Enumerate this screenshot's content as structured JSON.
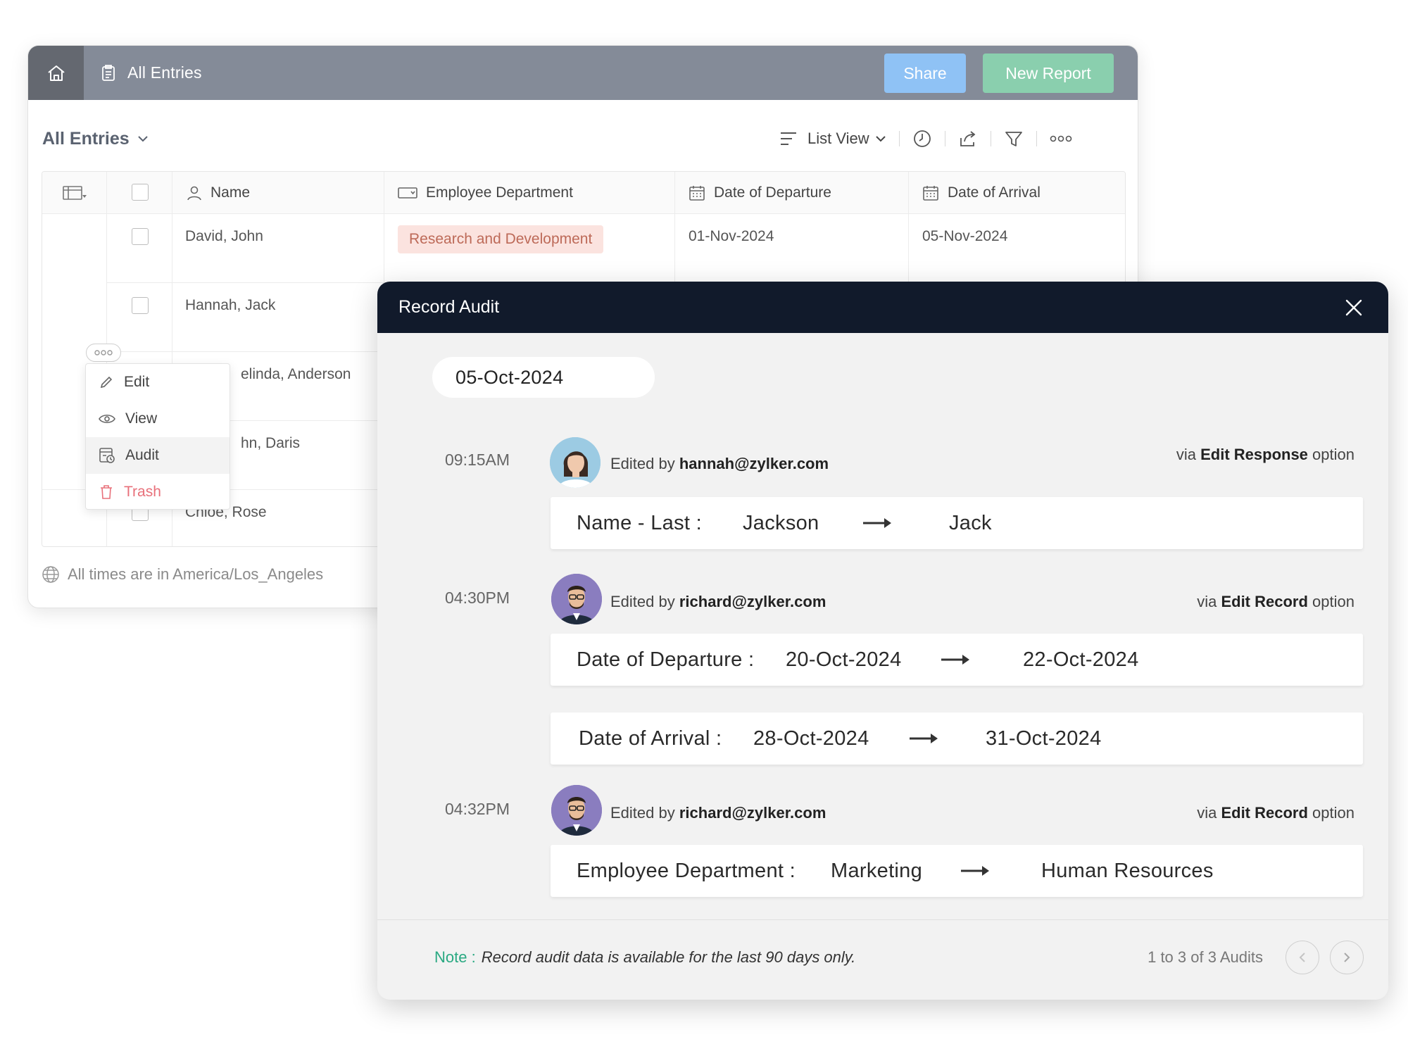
{
  "topbar": {
    "title": "All Entries",
    "share_label": "Share",
    "new_report_label": "New Report",
    "icons": [
      "home-icon",
      "report-icon"
    ],
    "colors": {
      "bar": "#848b98",
      "home": "#646870",
      "share": "#8fc2f5",
      "new_report": "#8acfae"
    }
  },
  "list": {
    "title": "All Entries",
    "view_label": "List View"
  },
  "table": {
    "headers": {
      "name": "Name",
      "department": "Employee Department",
      "departure": "Date of Departure",
      "arrival": "Date of Arrival"
    },
    "rows": [
      {
        "name": "David, John",
        "department": "Research and Development",
        "departure": "01-Nov-2024",
        "arrival": "05-Nov-2024"
      },
      {
        "name": "Hannah, Jack"
      },
      {
        "name": "elinda, Anderson"
      },
      {
        "name": "hn, Daris"
      },
      {
        "name": "Chloe, Rose"
      }
    ],
    "timezone_note": "All times are in America/Los_Angeles"
  },
  "context_menu": {
    "items": [
      {
        "label": "Edit",
        "icon": "pencil-icon"
      },
      {
        "label": "View",
        "icon": "eye-icon"
      },
      {
        "label": "Audit",
        "icon": "audit-icon"
      },
      {
        "label": "Trash",
        "icon": "trash-icon"
      }
    ]
  },
  "audit": {
    "title": "Record Audit",
    "date": "05-Oct-2024",
    "entries": [
      {
        "time": "09:15AM",
        "edited_prefix": "Edited by",
        "editor": "hannah@zylker.com",
        "via_prefix": "via",
        "via_option": "Edit Response",
        "via_suffix": "option",
        "changes": [
          {
            "field": "Name - Last :",
            "old": "Jackson",
            "new": "Jack"
          }
        ]
      },
      {
        "time": "04:30PM",
        "edited_prefix": "Edited by",
        "editor": "richard@zylker.com",
        "via_prefix": "via",
        "via_option": "Edit Record",
        "via_suffix": "option",
        "changes": [
          {
            "field": "Date of Departure :",
            "old": "20-Oct-2024",
            "new": "22-Oct-2024"
          },
          {
            "field": "Date of Arrival :",
            "old": "28-Oct-2024",
            "new": "31-Oct-2024"
          }
        ]
      },
      {
        "time": "04:32PM",
        "edited_prefix": "Edited by",
        "editor": "richard@zylker.com",
        "via_prefix": "via",
        "via_option": "Edit Record",
        "via_suffix": "option",
        "changes": [
          {
            "field": "Employee Department :",
            "old": "Marketing",
            "new": "Human Resources"
          }
        ]
      }
    ],
    "note_label": "Note :",
    "note_text": "Record audit data is available for the last 90 days only.",
    "count": "1 to 3 of 3 Audits",
    "colors": {
      "header": "#111a2b",
      "note": "#2aa982"
    }
  }
}
